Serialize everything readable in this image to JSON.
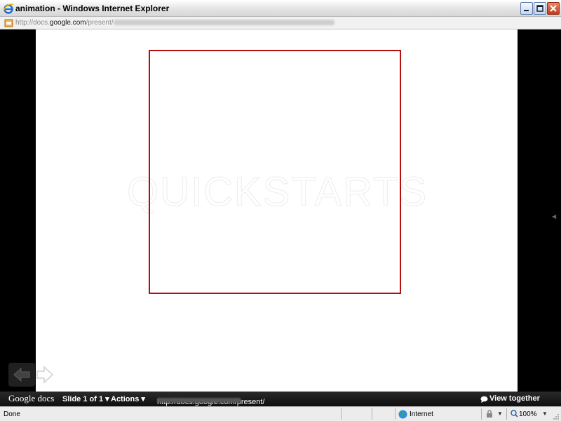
{
  "window": {
    "title": "animation - Windows Internet Explorer"
  },
  "address": {
    "prefix": "http://docs.",
    "domain": "google.com",
    "path": "/present/"
  },
  "slide": {
    "watermark": "QUICKSTARTS"
  },
  "toolbar": {
    "logo": "Google docs",
    "slide_indicator": "Slide 1 of 1 ▾",
    "actions": "Actions ▾",
    "present_url": "http://docs.google.com/present/",
    "view_together": "View together"
  },
  "status": {
    "text": "Done",
    "zone": "Internet",
    "zoom": "100%"
  },
  "colors": {
    "frame": "#b30f0f",
    "toolbar_bg": "#111111"
  }
}
